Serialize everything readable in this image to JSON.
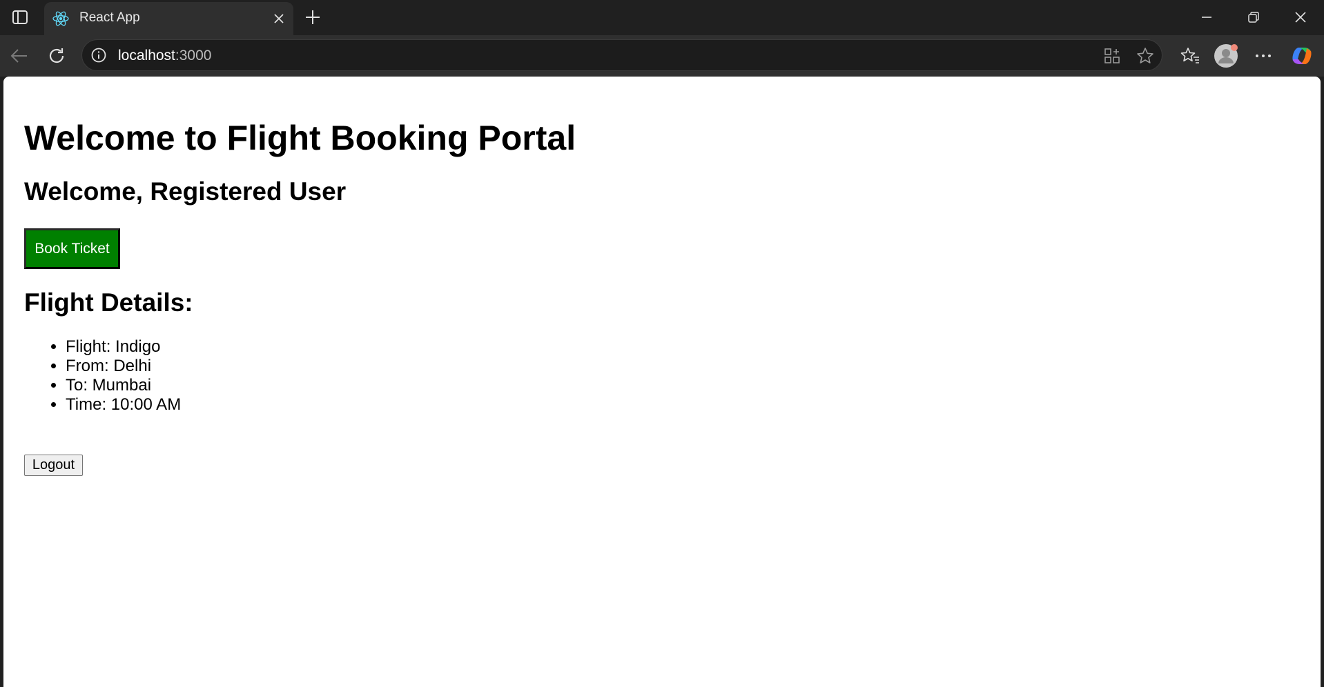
{
  "browser": {
    "tab_title": "React App",
    "url_host": "localhost",
    "url_port": ":3000"
  },
  "page": {
    "heading": "Welcome to Flight Booking Portal",
    "welcome": "Welcome, Registered User",
    "book_button_label": "Book Ticket",
    "details_heading": "Flight Details:",
    "details": [
      "Flight: Indigo",
      "From: Delhi",
      "To: Mumbai",
      "Time: 10:00 AM"
    ],
    "logout_label": "Logout"
  },
  "colors": {
    "book_button_bg": "#008000",
    "react_logo": "#61dafb"
  }
}
